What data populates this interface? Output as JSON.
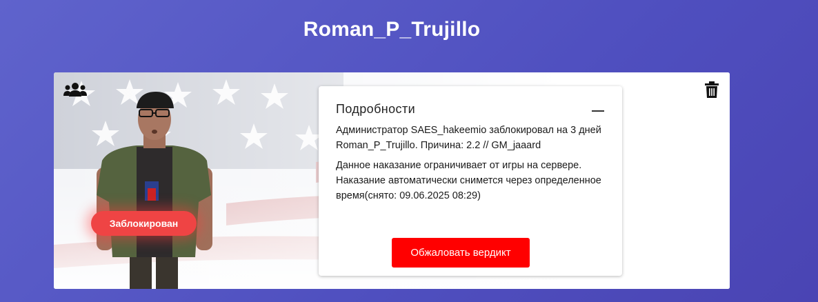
{
  "header": {
    "player_name": "Roman_P_Trujillo"
  },
  "card": {
    "icons": {
      "group": "users-icon",
      "delete": "trash-icon"
    },
    "status_badge": {
      "label": "Заблокирован",
      "color": "#ef4444"
    },
    "details": {
      "title": "Подробности",
      "text_1": "Администратор SAES_hakeemio заблокировал на 3 дней Roman_P_Trujillo. Причина: 2.2 // GM_jaaard",
      "text_2": "Данное наказание ограничивает от игры на сервере. Наказание автоматически снимется через определенное время(снято: 09.06.2025 08:29)",
      "appeal_button": "Обжаловать вердикт",
      "accent_color": "#ff0000"
    }
  }
}
